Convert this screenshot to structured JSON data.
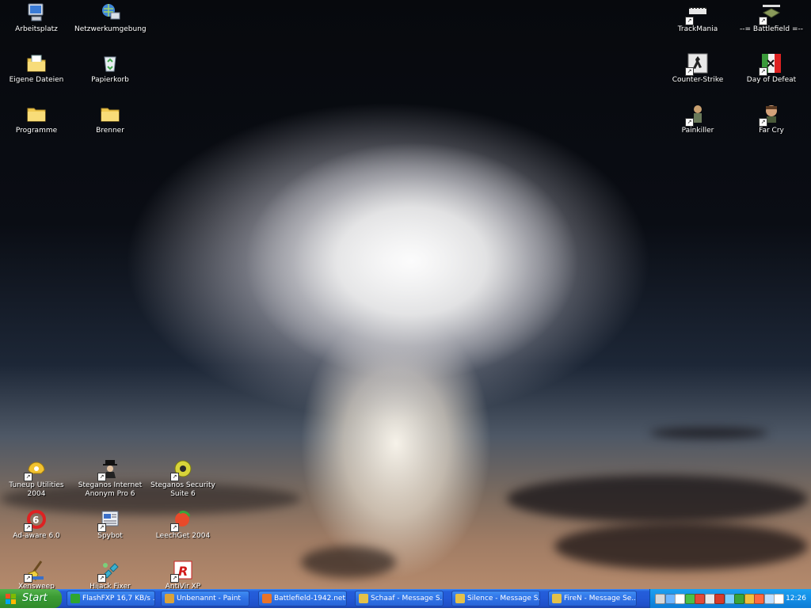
{
  "desktop": {
    "icons": [
      {
        "label": "Arbeitsplatz",
        "icon": "my-computer-icon"
      },
      {
        "label": "Netzwerkumgebung",
        "icon": "network-icon"
      },
      {
        "label": "Eigene Dateien",
        "icon": "my-documents-icon"
      },
      {
        "label": "Papierkorb",
        "icon": "recycle-bin-icon"
      },
      {
        "label": "Programme",
        "icon": "folder-icon"
      },
      {
        "label": "Brenner",
        "icon": "folder-icon"
      },
      {
        "label": "TrackMania",
        "icon": "trackmania-icon"
      },
      {
        "label": "--= Battlefield =--",
        "icon": "battlefield-icon"
      },
      {
        "label": "Counter-Strike",
        "icon": "counter-strike-icon"
      },
      {
        "label": "Day of Defeat",
        "icon": "day-of-defeat-icon"
      },
      {
        "label": "Painkiller",
        "icon": "painkiller-icon"
      },
      {
        "label": "Far Cry",
        "icon": "far-cry-icon"
      },
      {
        "label": "Tuneup Utilities 2004",
        "icon": "tuneup-icon"
      },
      {
        "label": "Steganos Internet Anonym Pro 6",
        "icon": "steganos-anonym-icon"
      },
      {
        "label": "Steganos Security Suite 6",
        "icon": "steganos-security-icon"
      },
      {
        "label": "Ad-aware 6.0",
        "icon": "ad-aware-icon"
      },
      {
        "label": "Spybot",
        "icon": "spybot-icon"
      },
      {
        "label": "LeechGet 2004",
        "icon": "leechget-icon"
      },
      {
        "label": "Xensweep",
        "icon": "xensweep-icon"
      },
      {
        "label": "Hijack Fixer",
        "icon": "hijack-fixer-icon"
      },
      {
        "label": "AntiVir XP",
        "icon": "antivir-icon"
      }
    ]
  },
  "taskbar": {
    "start_label": "Start",
    "tasks": [
      {
        "label": "FlashFXP 16,7 KB/s ...",
        "icon": "flashfxp-icon",
        "color": "#2fa52f"
      },
      {
        "label": "Unbenannt - Paint",
        "icon": "paint-icon",
        "color": "#d9a23a"
      },
      {
        "label": "Battlefield-1942.net...",
        "icon": "firefox-icon",
        "color": "#e8732a"
      },
      {
        "label": "Schaaf - Message S...",
        "icon": "messenger-icon",
        "color": "#e3c14a"
      },
      {
        "label": "Silence - Message S...",
        "icon": "messenger-icon",
        "color": "#e3c14a"
      },
      {
        "label": "FireN - Message Se...",
        "icon": "messenger-icon",
        "color": "#e3c14a"
      }
    ],
    "tray_colors": [
      "#d8d8d8",
      "#6fb6ff",
      "#ffffff",
      "#4ac14a",
      "#e04a3a",
      "#e8e8e8",
      "#d63b2b",
      "#7fd0ff",
      "#3aa53a",
      "#f0c040",
      "#ff6a40",
      "#c0e0ff",
      "#ffffff"
    ],
    "clock": "12:26"
  }
}
